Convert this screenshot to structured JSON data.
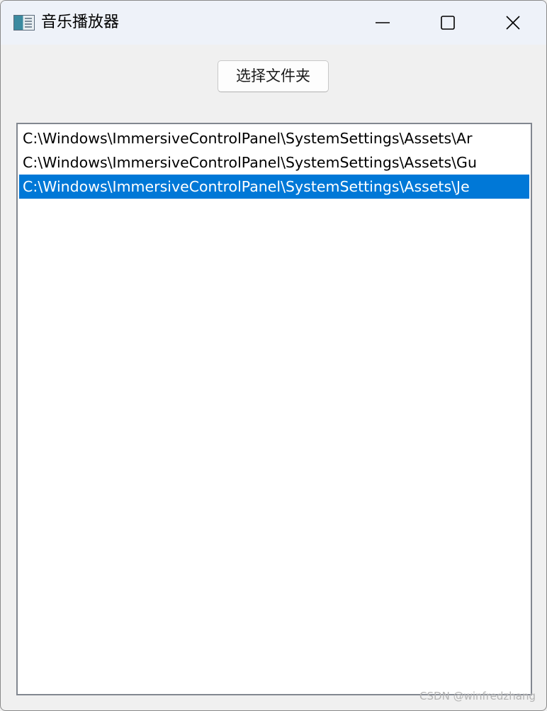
{
  "window": {
    "title": "音乐播放器"
  },
  "toolbar": {
    "select_folder_label": "选择文件夹"
  },
  "file_list": {
    "items": [
      {
        "path": "C:\\Windows\\ImmersiveControlPanel\\SystemSettings\\Assets\\Ar",
        "selected": false
      },
      {
        "path": "C:\\Windows\\ImmersiveControlPanel\\SystemSettings\\Assets\\Gu",
        "selected": false
      },
      {
        "path": "C:\\Windows\\ImmersiveControlPanel\\SystemSettings\\Assets\\Je",
        "selected": true
      }
    ]
  },
  "watermark": {
    "text": "CSDN @winfredzhang"
  },
  "colors": {
    "selection": "#0078d7",
    "titlebar": "#eef2f9",
    "window_bg": "#f0f0f0"
  }
}
